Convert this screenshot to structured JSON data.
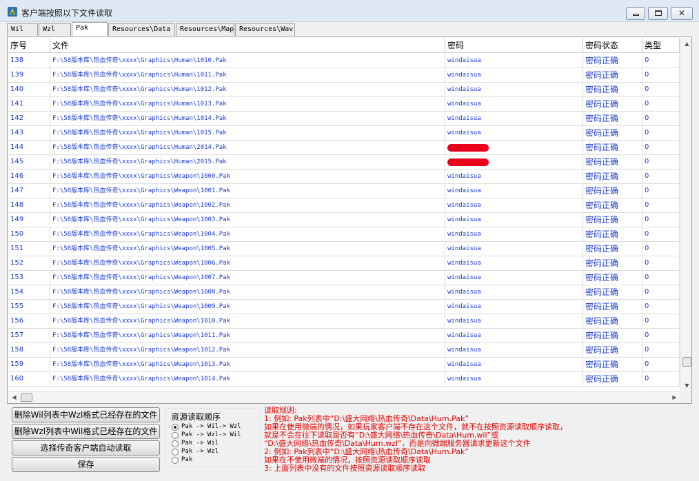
{
  "window": {
    "title": "客户端按照以下文件读取",
    "close_glyph": "✕"
  },
  "tabs": [
    {
      "label": "Wil",
      "active": false
    },
    {
      "label": "Wzl",
      "active": false
    },
    {
      "label": "Pak",
      "active": true
    },
    {
      "label": "Resources\\Data",
      "active": false
    },
    {
      "label": "Resources\\Map",
      "active": false
    },
    {
      "label": "Resources\\Wav",
      "active": false
    }
  ],
  "grid": {
    "columns": {
      "id": "序号",
      "file": "文件",
      "password": "密码",
      "status": "密码状态",
      "type": "类型"
    },
    "rows": [
      {
        "id": "138",
        "file": "F:\\58版本库\\热血传奇\\xxxx\\Graphics\\Human\\1010.Pak",
        "password": "windaisua",
        "status": "密码正确",
        "type": "0"
      },
      {
        "id": "139",
        "file": "F:\\58版本库\\热血传奇\\xxxx\\Graphics\\Human\\1011.Pak",
        "password": "windaisua",
        "status": "密码正确",
        "type": "0"
      },
      {
        "id": "140",
        "file": "F:\\58版本库\\热血传奇\\xxxx\\Graphics\\Human\\1012.Pak",
        "password": "windaisua",
        "status": "密码正确",
        "type": "0"
      },
      {
        "id": "141",
        "file": "F:\\58版本库\\热血传奇\\xxxx\\Graphics\\Human\\1013.Pak",
        "password": "windaisua",
        "status": "密码正确",
        "type": "0"
      },
      {
        "id": "142",
        "file": "F:\\58版本库\\热血传奇\\xxxx\\Graphics\\Human\\1014.Pak",
        "password": "windaisua",
        "status": "密码正确",
        "type": "0"
      },
      {
        "id": "143",
        "file": "F:\\58版本库\\热血传奇\\xxxx\\Graphics\\Human\\1015.Pak",
        "password": "windaisua",
        "status": "密码正确",
        "type": "0"
      },
      {
        "id": "144",
        "file": "F:\\58版本库\\热血传奇\\xxxx\\Graphics\\Human\\2014.Pak",
        "password": "",
        "redacted": true,
        "status": "密码正确",
        "type": "0"
      },
      {
        "id": "145",
        "file": "F:\\58版本库\\热血传奇\\xxxx\\Graphics\\Human\\2015.Pak",
        "password": "",
        "redacted": true,
        "status": "密码正确",
        "type": "0"
      },
      {
        "id": "146",
        "file": "F:\\58版本库\\热血传奇\\xxxx\\Graphics\\Weapon\\1000.Pak",
        "password": "windaisua",
        "status": "密码正确",
        "type": "0"
      },
      {
        "id": "147",
        "file": "F:\\58版本库\\热血传奇\\xxxx\\Graphics\\Weapon\\1001.Pak",
        "password": "windaisua",
        "status": "密码正确",
        "type": "0"
      },
      {
        "id": "148",
        "file": "F:\\58版本库\\热血传奇\\xxxx\\Graphics\\Weapon\\1002.Pak",
        "password": "windaisua",
        "status": "密码正确",
        "type": "0"
      },
      {
        "id": "149",
        "file": "F:\\58版本库\\热血传奇\\xxxx\\Graphics\\Weapon\\1003.Pak",
        "password": "windaisua",
        "status": "密码正确",
        "type": "0"
      },
      {
        "id": "150",
        "file": "F:\\58版本库\\热血传奇\\xxxx\\Graphics\\Weapon\\1004.Pak",
        "password": "windaisua",
        "status": "密码正确",
        "type": "0"
      },
      {
        "id": "151",
        "file": "F:\\58版本库\\热血传奇\\xxxx\\Graphics\\Weapon\\1005.Pak",
        "password": "windaisua",
        "status": "密码正确",
        "type": "0"
      },
      {
        "id": "152",
        "file": "F:\\58版本库\\热血传奇\\xxxx\\Graphics\\Weapon\\1006.Pak",
        "password": "windaisua",
        "status": "密码正确",
        "type": "0"
      },
      {
        "id": "153",
        "file": "F:\\58版本库\\热血传奇\\xxxx\\Graphics\\Weapon\\1007.Pak",
        "password": "windaisua",
        "status": "密码正确",
        "type": "0"
      },
      {
        "id": "154",
        "file": "F:\\58版本库\\热血传奇\\xxxx\\Graphics\\Weapon\\1008.Pak",
        "password": "windaisua",
        "status": "密码正确",
        "type": "0"
      },
      {
        "id": "155",
        "file": "F:\\58版本库\\热血传奇\\xxxx\\Graphics\\Weapon\\1009.Pak",
        "password": "windaisua",
        "status": "密码正确",
        "type": "0"
      },
      {
        "id": "156",
        "file": "F:\\58版本库\\热血传奇\\xxxx\\Graphics\\Weapon\\1010.Pak",
        "password": "windaisua",
        "status": "密码正确",
        "type": "0"
      },
      {
        "id": "157",
        "file": "F:\\58版本库\\热血传奇\\xxxx\\Graphics\\Weapon\\1011.Pak",
        "password": "windaisua",
        "status": "密码正确",
        "type": "0"
      },
      {
        "id": "158",
        "file": "F:\\58版本库\\热血传奇\\xxxx\\Graphics\\Weapon\\1012.Pak",
        "password": "windaisua",
        "status": "密码正确",
        "type": "0"
      },
      {
        "id": "159",
        "file": "F:\\58版本库\\热血传奇\\xxxx\\Graphics\\Weapon\\1013.Pak",
        "password": "windaisua",
        "status": "密码正确",
        "type": "0"
      },
      {
        "id": "160",
        "file": "F:\\58版本库\\热血传奇\\xxxx\\Graphics\\Weapon\\1014.Pak",
        "password": "windaisua",
        "status": "密码正确",
        "type": "0"
      }
    ]
  },
  "icons": {
    "scroll_up": "▲",
    "scroll_down": "▼",
    "scroll_left": "◀",
    "scroll_right": "▶"
  },
  "actions": {
    "delete_wil": "删除Wil列表中Wzl格式已经存在的文件",
    "delete_wzl": "删除Wzl列表中Wil格式已经存在的文件",
    "choose_client": "选择传奇客户端自动读取",
    "save": "保存"
  },
  "load_order": {
    "title": "资源读取顺序",
    "options": [
      {
        "label": "Pak -> Wil-> Wzl",
        "checked": true
      },
      {
        "label": "Pak -> Wzl-> Wil",
        "checked": false
      },
      {
        "label": "Pak -> Wil",
        "checked": false
      },
      {
        "label": "Pak -> Wzl",
        "checked": false
      },
      {
        "label": "Pak",
        "checked": false
      }
    ]
  },
  "rules": {
    "lines": [
      "读取规则:",
      "1: 例如: Pak列表中“D:\\盛大网络\\热血传奇\\Data\\Hum.Pak”",
      "    如果在使用微端的情况，如果玩家客户端不存在这个文件，就不在按照资源读取顺序读取，",
      "    就是不会在往下读取是否有“D:\\盛大网络\\热血传奇\\Data\\Hum.wil”或",
      "   “D:\\盛大网络\\热血传奇\\Data\\Hum.wzl”，而是向微端服务器请求更新这个文件",
      "2: 例如: Pak列表中“D:\\盛大网络\\热血传奇\\Data\\Hum.Pak”",
      "    如果在不使用微端的情况，按照资源读取顺序读取",
      "3: 上面列表中没有的文件按照资源读取顺序读取"
    ]
  }
}
